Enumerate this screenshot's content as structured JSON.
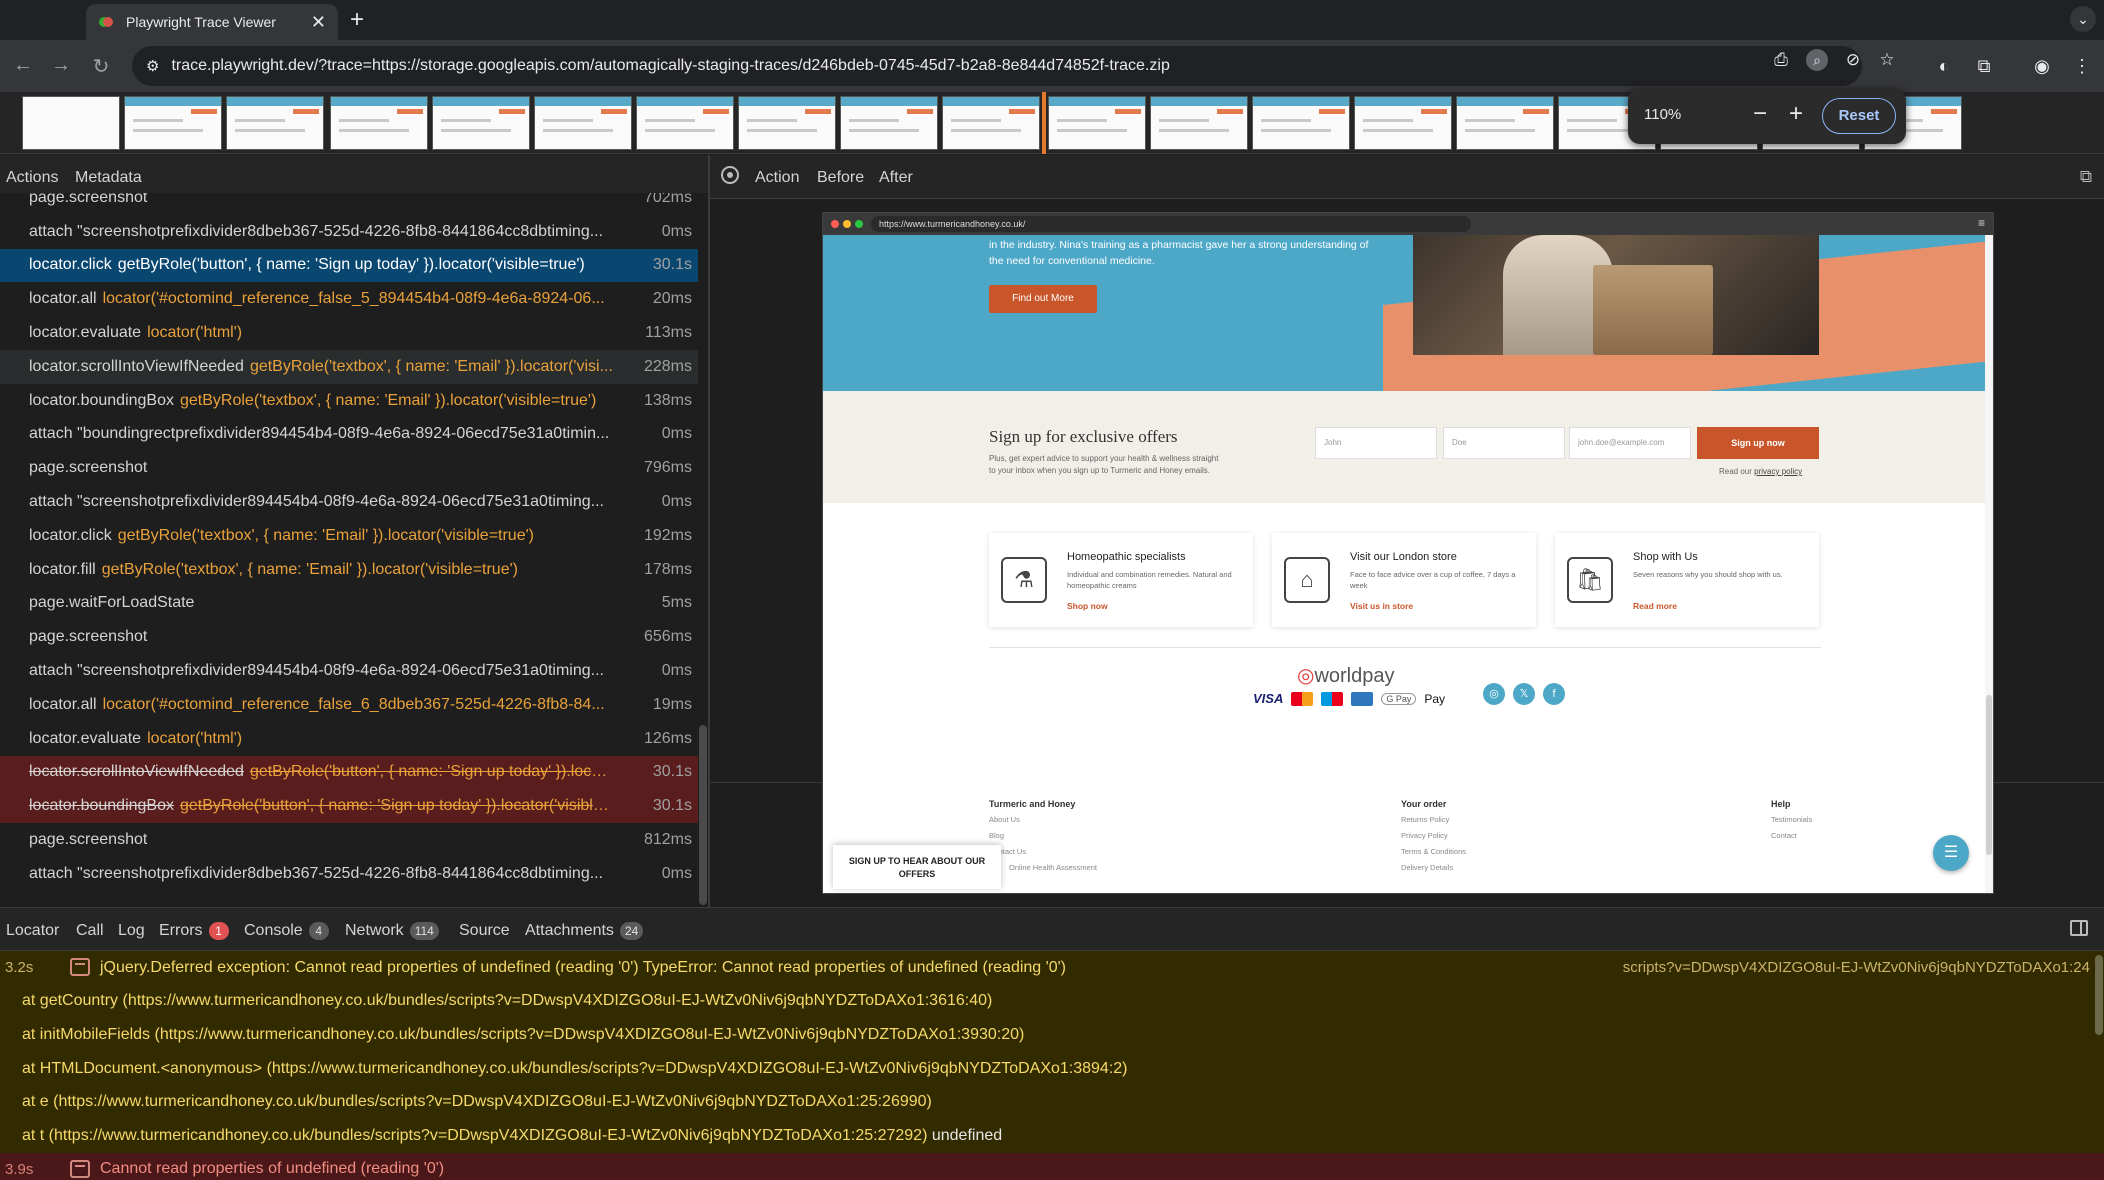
{
  "browser": {
    "tab_title": "Playwright Trace Viewer",
    "tab_close": "✕",
    "new_tab": "+",
    "url": "trace.playwright.dev/?trace=https://storage.googleapis.com/automagically-staging-traces/d246bdeb-0745-45d7-b2a8-8e844d74852f-trace.zip",
    "back": "←",
    "forward": "→",
    "reload": "↻",
    "tab_search": "⌄"
  },
  "zoom": {
    "value": "110%",
    "minus": "−",
    "plus": "+",
    "reset": "Reset"
  },
  "left_tabs": {
    "actions": "Actions",
    "metadata": "Metadata"
  },
  "actions": [
    {
      "title": "page.screenshot",
      "selector": "",
      "duration": "702ms",
      "state": "normal"
    },
    {
      "title": "attach \"screenshotprefixdivider8dbeb367-525d-4226-8fb8-8441864cc8dbtiming...",
      "selector": "",
      "duration": "0ms",
      "state": "normal"
    },
    {
      "title": "locator.click",
      "selector": "getByRole('button', { name: 'Sign up today' }).locator('visible=true')",
      "duration": "30.1s",
      "state": "selected"
    },
    {
      "title": "locator.all",
      "selector": "locator('#octomind_reference_false_5_894454b4-08f9-4e6a-8924-06...",
      "duration": "20ms",
      "state": "normal"
    },
    {
      "title": "locator.evaluate",
      "selector": "locator('html')",
      "duration": "113ms",
      "state": "normal"
    },
    {
      "title": "locator.scrollIntoViewIfNeeded",
      "selector": "getByRole('textbox', { name: 'Email' }).locator('visi...",
      "duration": "228ms",
      "state": "hover"
    },
    {
      "title": "locator.boundingBox",
      "selector": "getByRole('textbox', { name: 'Email' }).locator('visible=true')",
      "duration": "138ms",
      "state": "normal"
    },
    {
      "title": "attach \"boundingrectprefixdivider894454b4-08f9-4e6a-8924-06ecd75e31a0timin...",
      "selector": "",
      "duration": "0ms",
      "state": "normal"
    },
    {
      "title": "page.screenshot",
      "selector": "",
      "duration": "796ms",
      "state": "normal"
    },
    {
      "title": "attach \"screenshotprefixdivider894454b4-08f9-4e6a-8924-06ecd75e31a0timing...",
      "selector": "",
      "duration": "0ms",
      "state": "normal"
    },
    {
      "title": "locator.click",
      "selector": "getByRole('textbox', { name: 'Email' }).locator('visible=true')",
      "duration": "192ms",
      "state": "normal"
    },
    {
      "title": "locator.fill",
      "selector": "getByRole('textbox', { name: 'Email' }).locator('visible=true')",
      "duration": "178ms",
      "state": "normal"
    },
    {
      "title": "page.waitForLoadState",
      "selector": "",
      "duration": "5ms",
      "state": "normal"
    },
    {
      "title": "page.screenshot",
      "selector": "",
      "duration": "656ms",
      "state": "normal"
    },
    {
      "title": "attach \"screenshotprefixdivider894454b4-08f9-4e6a-8924-06ecd75e31a0timing...",
      "selector": "",
      "duration": "0ms",
      "state": "normal"
    },
    {
      "title": "locator.all",
      "selector": "locator('#octomind_reference_false_6_8dbeb367-525d-4226-8fb8-84...",
      "duration": "19ms",
      "state": "normal"
    },
    {
      "title": "locator.evaluate",
      "selector": "locator('html')",
      "duration": "126ms",
      "state": "normal"
    },
    {
      "title": "locator.scrollIntoViewIfNeeded",
      "selector": "getByRole('button', { name: 'Sign up today' }).locat...",
      "duration": "30.1s",
      "state": "error"
    },
    {
      "title": "locator.boundingBox",
      "selector": "getByRole('button', { name: 'Sign up today' }).locator('visible...",
      "duration": "30.1s",
      "state": "error"
    },
    {
      "title": "page.screenshot",
      "selector": "",
      "duration": "812ms",
      "state": "normal"
    },
    {
      "title": "attach \"screenshotprefixdivider8dbeb367-525d-4226-8fb8-8441864cc8dbtiming...",
      "selector": "",
      "duration": "0ms",
      "state": "normal"
    }
  ],
  "right_tabs": {
    "action": "Action",
    "before": "Before",
    "after": "After",
    "popout": "⧉"
  },
  "snapshot": {
    "url": "https://www.turmericandhoney.co.uk/",
    "menu": "≡",
    "hero_text": "in the industry. Nina's training as a pharmacist gave her a strong understanding of the need for conventional medicine.",
    "hero_button": "Find out More",
    "signup_title": "Sign up for exclusive offers",
    "signup_sub": "Plus, get expert advice to support your health & wellness straight to your inbox when you sign up to Turmeric and Honey emails.",
    "first_name": "John",
    "last_name": "Doe",
    "email": "john.doe@example.com",
    "signup_button": "Sign up now",
    "privacy_prefix": "Read our",
    "privacy_link": "privacy policy",
    "features": [
      {
        "title": "Homeopathic specialists",
        "desc": "Individual and combination remedies. Natural and homeopathic creams",
        "link": "Shop now",
        "icon": "⚗"
      },
      {
        "title": "Visit our London store",
        "desc": "Face to face advice over a cup of coffee, 7 days a week",
        "link": "Visit us in store",
        "icon": "⌂"
      },
      {
        "title": "Shop with Us",
        "desc": "Seven reasons why you should shop with us.",
        "link": "Read more",
        "icon": "🛍"
      }
    ],
    "worldpay_prefix": "◎",
    "worldpay": "worldpay",
    "visa": "VISA",
    "gpay": "G Pay",
    "applepay": " Pay",
    "social": [
      "◎",
      "𝕏",
      "f"
    ],
    "footer": {
      "col1_title": "Turmeric and Honey",
      "col1_items": [
        "About Us",
        "Blog",
        "Contact Us",
        "Online Health Assessment"
      ],
      "col2_title": "Your order",
      "col2_items": [
        "Returns Policy",
        "Privacy Policy",
        "Terms & Conditions",
        "Delivery Details"
      ],
      "col3_title": "Help",
      "col3_items": [
        "Testimonials",
        "Contact"
      ]
    },
    "newsletter_tab": "SIGN UP TO HEAR ABOUT OUR OFFERS",
    "chat": "☰"
  },
  "bottom_tabs": {
    "locator": "Locator",
    "call": "Call",
    "log": "Log",
    "errors": "Errors",
    "errors_count": "1",
    "console": "Console",
    "console_count": "4",
    "network": "Network",
    "network_count": "114",
    "source": "Source",
    "attachments": "Attachments",
    "attachments_count": "24"
  },
  "console": {
    "row1_time": "3.2s",
    "row1_msg": "jQuery.Deferred exception: Cannot read properties of undefined (reading '0') TypeError: Cannot read properties of undefined (reading '0')",
    "row1_src": "scripts?v=DDwspV4XDIZGO8uI-EJ-WtZv0Niv6j9qbNYDZToDAXo1:24",
    "stack": [
      "at getCountry (https://www.turmericandhoney.co.uk/bundles/scripts?v=DDwspV4XDIZGO8uI-EJ-WtZv0Niv6j9qbNYDZToDAXo1:3616:40)",
      "at initMobileFields (https://www.turmericandhoney.co.uk/bundles/scripts?v=DDwspV4XDIZGO8uI-EJ-WtZv0Niv6j9qbNYDZToDAXo1:3930:20)",
      "at HTMLDocument.<anonymous> (https://www.turmericandhoney.co.uk/bundles/scripts?v=DDwspV4XDIZGO8uI-EJ-WtZv0Niv6j9qbNYDZToDAXo1:3894:2)",
      "at e (https://www.turmericandhoney.co.uk/bundles/scripts?v=DDwspV4XDIZGO8uI-EJ-WtZv0Niv6j9qbNYDZToDAXo1:25:26990)",
      "at t (https://www.turmericandhoney.co.uk/bundles/scripts?v=DDwspV4XDIZGO8uI-EJ-WtZv0Niv6j9qbNYDZToDAXo1:25:27292)"
    ],
    "stack_suffix": "undefined",
    "row2_time": "3.9s",
    "row2_msg": "Cannot read properties of undefined (reading '0')"
  },
  "colors": {
    "selected": "#094771",
    "error_row": "#5a1d1d",
    "selector": "#e9a23b",
    "console_warn_bg": "#332b00",
    "brand_orange": "#c9562b",
    "brand_blue": "#4da8c8"
  }
}
